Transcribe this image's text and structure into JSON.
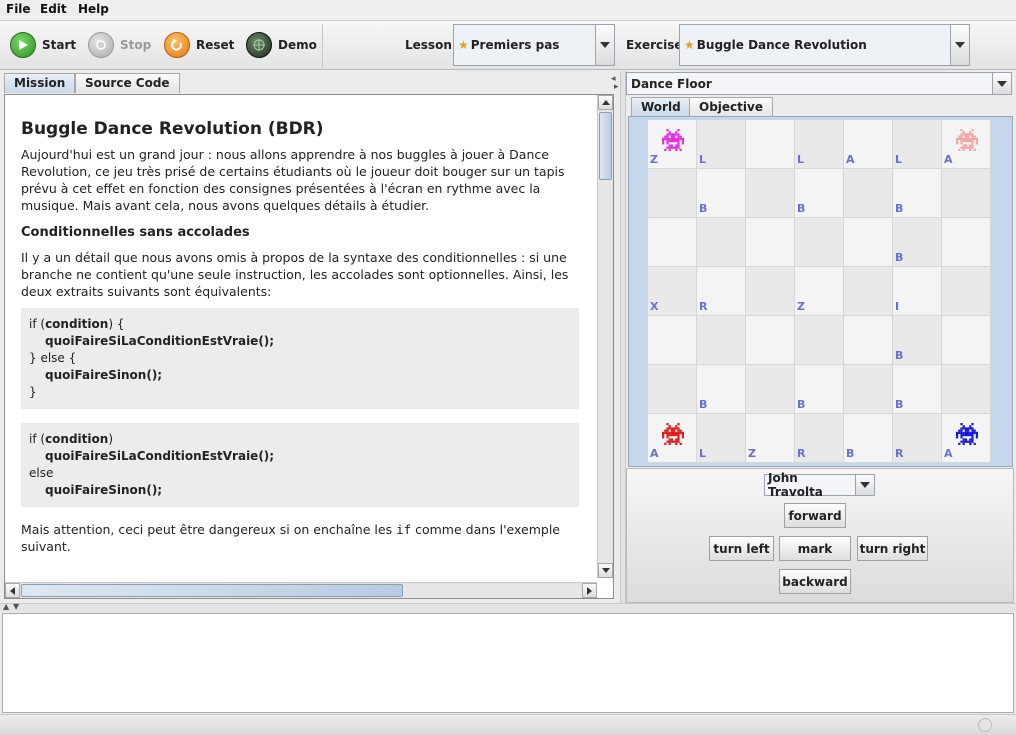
{
  "menu": {
    "items": [
      "File",
      "Edit",
      "Help"
    ]
  },
  "toolbar": {
    "start": "Start",
    "stop": "Stop",
    "reset": "Reset",
    "demo": "Demo",
    "lesson_label": "Lesson:",
    "lesson_value": "Premiers pas",
    "exercise_label": "Exercise:",
    "exercise_value": "Buggle Dance Revolution"
  },
  "left_tabs": [
    "Mission",
    "Source Code"
  ],
  "mission": {
    "title": "Buggle Dance Revolution (BDR)",
    "intro": "Aujourd'hui est un grand jour : nous allons apprendre à nos buggles à jouer à Dance Revolution, ce jeu très prisé de certains étudiants où le joueur doit bouger sur un tapis prévu à cet effet en fonction des consignes présentées à l'écran en rythme avec la musique. Mais avant cela, nous avons quelques détails à étudier.",
    "section_title": "Conditionnelles sans accolades",
    "section_text": "Il y a un détail que nous avons omis à propos de la syntaxe des conditionnelles : si une branche ne contient qu'une seule instruction, les accolades sont optionnelles. Ainsi, les deux extraits suivants sont équivalents:",
    "code1": {
      "l1_a": "if (",
      "l1_b": "condition",
      "l1_c": ") {",
      "l2": "quoiFaireSiLaConditionEstVraie();",
      "l3": "} else {",
      "l4": "quoiFaireSinon();",
      "l5": "}"
    },
    "code2": {
      "l1_a": "if (",
      "l1_b": "condition",
      "l1_c": ")",
      "l2": "quoiFaireSiLaConditionEstVraie();",
      "l3": "else",
      "l4": "quoiFaireSinon();"
    },
    "warning_a": "Mais attention, ceci peut être dangereux si on enchaîne les ",
    "warning_code": "if",
    "warning_b": " comme dans l'exemple suivant."
  },
  "world": {
    "selector": "Dance Floor",
    "tabs": [
      "World",
      "Objective"
    ],
    "grid": [
      [
        "Z",
        "L",
        "",
        "L",
        "A",
        "L",
        "A"
      ],
      [
        "",
        "B",
        "",
        "B",
        "",
        "B",
        ""
      ],
      [
        "",
        "",
        "",
        "",
        "",
        "B",
        ""
      ],
      [
        "X",
        "R",
        "",
        "Z",
        "",
        "I",
        ""
      ],
      [
        "",
        "",
        "",
        "",
        "",
        "B",
        ""
      ],
      [
        "",
        "B",
        "",
        "B",
        "",
        "B",
        ""
      ],
      [
        "A",
        "L",
        "Z",
        "R",
        "B",
        "R",
        "A"
      ]
    ],
    "buggles": [
      {
        "row": 0,
        "col": 0,
        "color": "#e32ce0"
      },
      {
        "row": 0,
        "col": 6,
        "color": "#f2a4a4"
      },
      {
        "row": 6,
        "col": 0,
        "color": "#e01818"
      },
      {
        "row": 6,
        "col": 6,
        "color": "#1414d8"
      }
    ]
  },
  "controls": {
    "buggle": "John Travolta",
    "forward": "forward",
    "turn_left": "turn left",
    "mark": "mark",
    "turn_right": "turn right",
    "backward": "backward"
  }
}
